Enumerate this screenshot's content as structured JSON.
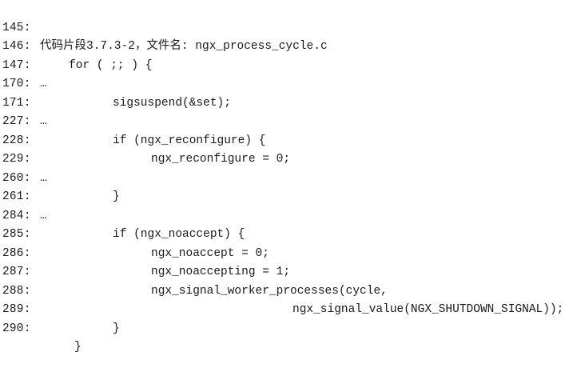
{
  "listing": {
    "lines": [
      {
        "no": "145:",
        "code": "代码片段3.7.3-2，文件名: ngx_process_cycle.c"
      },
      {
        "no": "146:",
        "code": "for ( ;; ) {"
      },
      {
        "no": "147:",
        "code": "…"
      },
      {
        "no": "170:",
        "code": "sigsuspend(&set);"
      },
      {
        "no": "171:",
        "code": "…"
      },
      {
        "no": "227:",
        "code": "if (ngx_reconfigure) {"
      },
      {
        "no": "228:",
        "code": "ngx_reconfigure = 0;"
      },
      {
        "no": "229:",
        "code": "…"
      },
      {
        "no": "260:",
        "code": "}"
      },
      {
        "no": "261:",
        "code": "…"
      },
      {
        "no": "284:",
        "code": "if (ngx_noaccept) {"
      },
      {
        "no": "285:",
        "code": "ngx_noaccept = 0;"
      },
      {
        "no": "286:",
        "code": "ngx_noaccepting = 1;"
      },
      {
        "no": "287:",
        "code": "ngx_signal_worker_processes(cycle,"
      },
      {
        "no": "288:",
        "code": "ngx_signal_value(NGX_SHUTDOWN_SIGNAL));"
      },
      {
        "no": "289:",
        "code": "}"
      },
      {
        "no": "290:",
        "code": "}"
      }
    ]
  }
}
